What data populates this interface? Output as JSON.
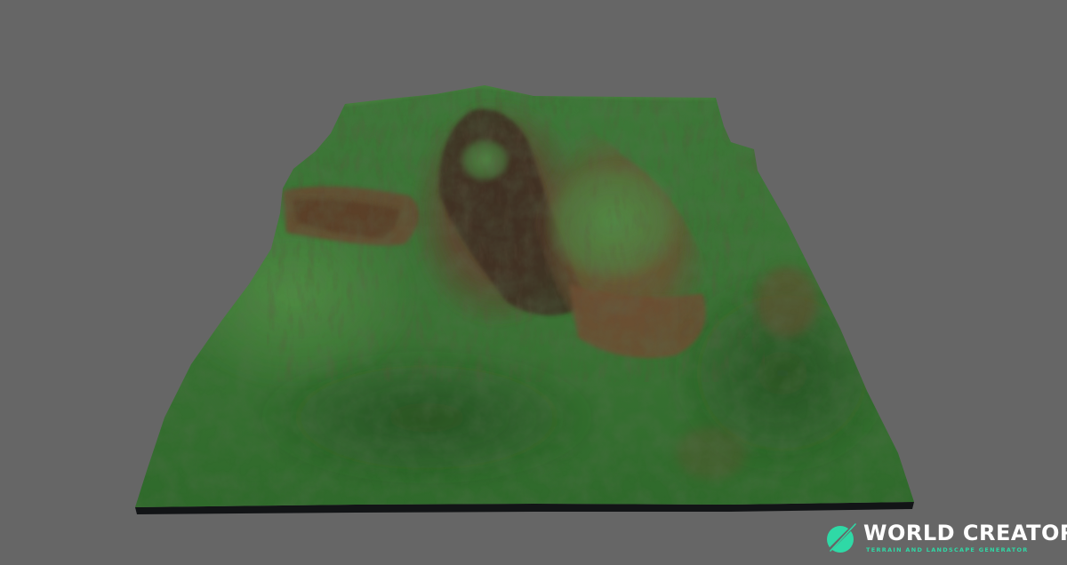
{
  "viewport": {
    "background": "#666666",
    "subject": "3d-terrain-heightmap",
    "palette": {
      "grass": "#3f7a3a",
      "grass_dark": "#2f5e2c",
      "grass_light": "#55923f",
      "rock": "#6b4a2f",
      "rock_dark": "#3a2c1e",
      "base": "#121416"
    }
  },
  "logo": {
    "title": "WORLD CREATOR",
    "subtitle": "TERRAIN AND LANDSCAPE GENERATOR",
    "icon": "world-creator-leaf-icon",
    "title_color": "#ffffff",
    "accent_color": "#2fd9a6"
  }
}
